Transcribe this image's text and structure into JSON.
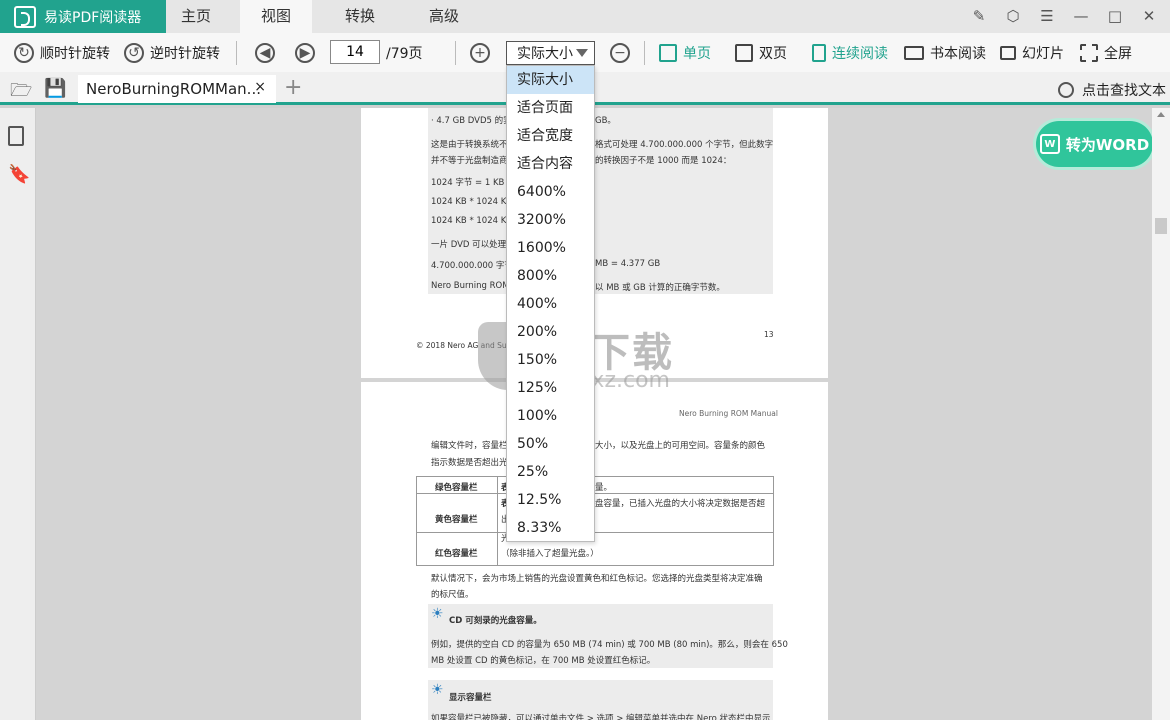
{
  "app": {
    "title": "易读PDF阅读器"
  },
  "menu": [
    "主页",
    "视图",
    "转换",
    "高级"
  ],
  "menu_active": "视图",
  "toolbar": {
    "rotate_cw": "顺时针旋转",
    "rotate_ccw": "逆时针旋转",
    "page_current": "14",
    "page_total": "/79页",
    "zoom_value": "实际大小",
    "single_page": "单页",
    "double_page": "双页",
    "continuous": "连续阅读",
    "book_mode": "书本阅读",
    "slideshow": "幻灯片",
    "fullscreen": "全屏"
  },
  "tabs": {
    "doc_name": "NeroBurningROMMan...",
    "close": "×",
    "add": "+"
  },
  "find_text": "点击查找文本",
  "to_word": "转为WORD",
  "zoom_options": [
    "实际大小",
    "适合页面",
    "适合宽度",
    "适合内容",
    "6400%",
    "3200%",
    "1600%",
    "800%",
    "400%",
    "200%",
    "150%",
    "125%",
    "100%",
    "50%",
    "25%",
    "12.5%",
    "8.33%"
  ],
  "page1": {
    "l1": "· 4.7 GB DVD5 的实",
    "l1b": "GB。",
    "l2": "这是由于转换系统不",
    "l2b": "格式可处理 4.700.000.000 个字节，但此数字",
    "l3": "并不等于光盘制造商",
    "l3b": "的转换因子不是 1000 而是 1024：",
    "l4": "1024 字节 = 1 KB",
    "l5": "1024 KB * 1024 KB =",
    "l6": "1024 KB * 1024 KB *",
    "l7": "一片 DVD 可以处理",
    "l8": "4.700.000.000 字节",
    "l8b": "MB = 4.377 GB",
    "l9": "Nero Burning ROM",
    "l9b": "以 MB 或 GB 计算的正确字节数。",
    "footer_left": "© 2018 Nero AG and Subs",
    "footer_num": "13"
  },
  "page2": {
    "header": "Nero Burning ROM Manual",
    "l1": "编辑文件时，容量栏",
    "l1b": "大小，以及光盘上的可用空间。容量条的颜色",
    "l2": "指示数据是否超出光",
    "t_r1a": "绿色容量栏",
    "t_r1b": "表",
    "t_r1c": "量。",
    "t_r2a": "黄色容量栏",
    "t_r2b": "表",
    "t_r2c": "盘容量，已插入光盘的大小将决定数据是否超",
    "t_r2d": "出",
    "t_r2e": "光",
    "t_r3a": "红色容量栏",
    "t_r3b": "（除非插入了超量光盘。）",
    "l3": "默认情况下，会为市场上销售的光盘设置黄色和红色标记。您选择的光盘类型将决定准确",
    "l4": "的标尺值。",
    "tip1_title": "CD 可刻录的光盘容量。",
    "tip1_l1": "例如，提供的空白 CD 的容量为 650 MB (74 min) 或 700 MB (80 min)。那么，则会在 650",
    "tip1_l2": "MB 处设置 CD 的黄色标记，在 700 MB 处设置红色标记。",
    "tip2_title": "显示容量栏",
    "tip2_l1": "如果容量栏已被隐藏，可以通过单击文件 > 选项 > 编辑菜单并选中在 Nero 状态栏中显示"
  },
  "watermark": {
    "main": "安下载",
    "sub": "anxz.com"
  }
}
